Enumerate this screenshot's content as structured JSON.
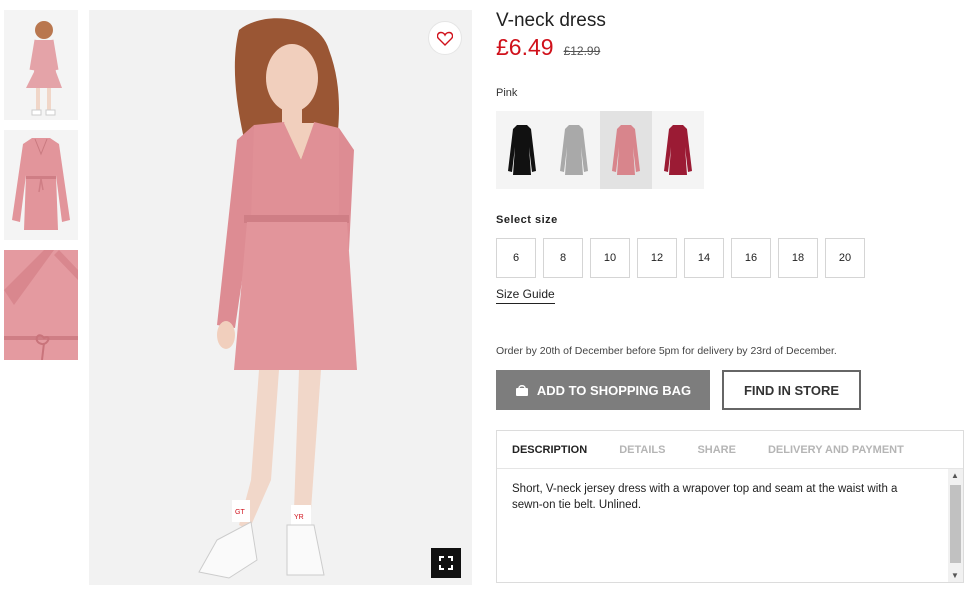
{
  "product": {
    "title": "V-neck dress",
    "price": "£6.49",
    "old_price": "£12.99",
    "color_label": "Pink",
    "size_heading": "Select size",
    "sizes": [
      "6",
      "8",
      "10",
      "12",
      "14",
      "16",
      "18",
      "20"
    ],
    "size_guide": "Size Guide",
    "order_note": "Order by 20th of December before 5pm for delivery by 23rd of December.",
    "add_to_bag": "ADD TO SHOPPING BAG",
    "find_in_store": "FIND IN STORE"
  },
  "swatches": [
    {
      "color": "#111111"
    },
    {
      "color": "#a9a9a9"
    },
    {
      "color": "#d8858c"
    },
    {
      "color": "#9b1b34"
    }
  ],
  "tabs": [
    "DESCRIPTION",
    "DETAILS",
    "SHARE",
    "DELIVERY AND PAYMENT"
  ],
  "description": "Short, V-neck jersey dress with a wrapover top and seam at the waist with a sewn-on tie belt. Unlined.",
  "colors": {
    "price_red": "#d0111b",
    "dress_pink": "#d8858c",
    "button_grey": "#7d7d7d"
  }
}
